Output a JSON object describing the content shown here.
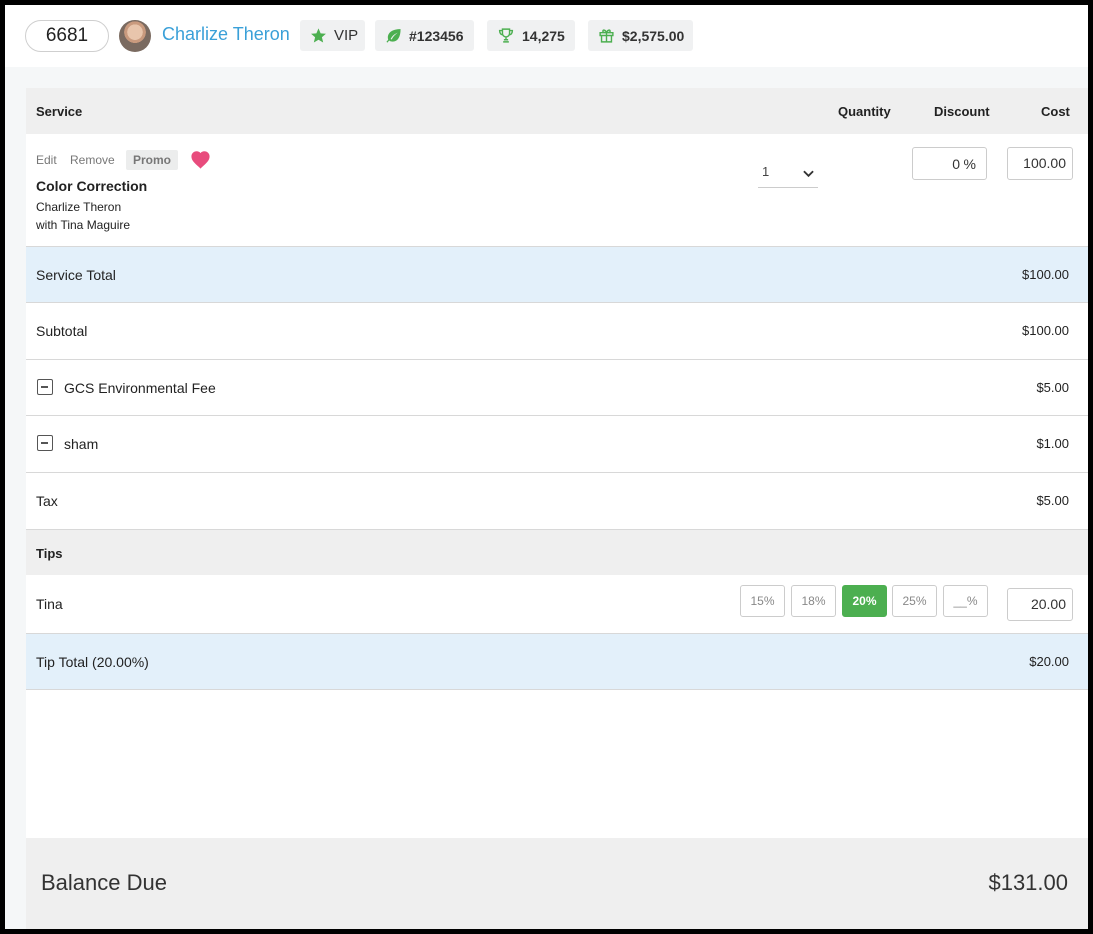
{
  "header": {
    "ticket_number": "6681",
    "client_name": "Charlize Theron",
    "chips": {
      "vip": {
        "label": "VIP",
        "icon": "star-icon"
      },
      "member_id": {
        "label": "#123456",
        "icon": "leaf-icon"
      },
      "points": {
        "label": "14,275",
        "icon": "trophy-icon"
      },
      "gift_balance": {
        "label": "$2,575.00",
        "icon": "gift-icon"
      }
    },
    "client_name_color": "#3aa0d8",
    "icon_color": "#4caf50"
  },
  "table": {
    "headers": {
      "service": "Service",
      "quantity": "Quantity",
      "discount": "Discount",
      "cost": "Cost"
    }
  },
  "service_item": {
    "edit_label": "Edit",
    "remove_label": "Remove",
    "promo_label": "Promo",
    "name": "Color Correction",
    "client": "Charlize Theron",
    "provider": "with Tina Maguire",
    "quantity": "1",
    "discount": "0",
    "discount_unit": "%",
    "cost": "100.00",
    "favorite_color": "#e84c7d"
  },
  "service_total": {
    "label": "Service Total",
    "amount": "$100.00"
  },
  "subtotal": {
    "label": "Subtotal",
    "amount": "$100.00"
  },
  "fees": [
    {
      "label": "GCS Environmental Fee",
      "amount": "$5.00"
    },
    {
      "label": "sham",
      "amount": "$1.00"
    }
  ],
  "tax": {
    "label": "Tax",
    "amount": "$5.00"
  },
  "tips": {
    "heading": "Tips",
    "staff": "Tina",
    "options": [
      "15%",
      "18%",
      "20%",
      "25%",
      "__%"
    ],
    "selected": "20%",
    "amount": "20.00",
    "total_label": "Tip Total (20.00%)",
    "total_amount": "$20.00"
  },
  "balance": {
    "label": "Balance Due",
    "amount": "$131.00"
  }
}
